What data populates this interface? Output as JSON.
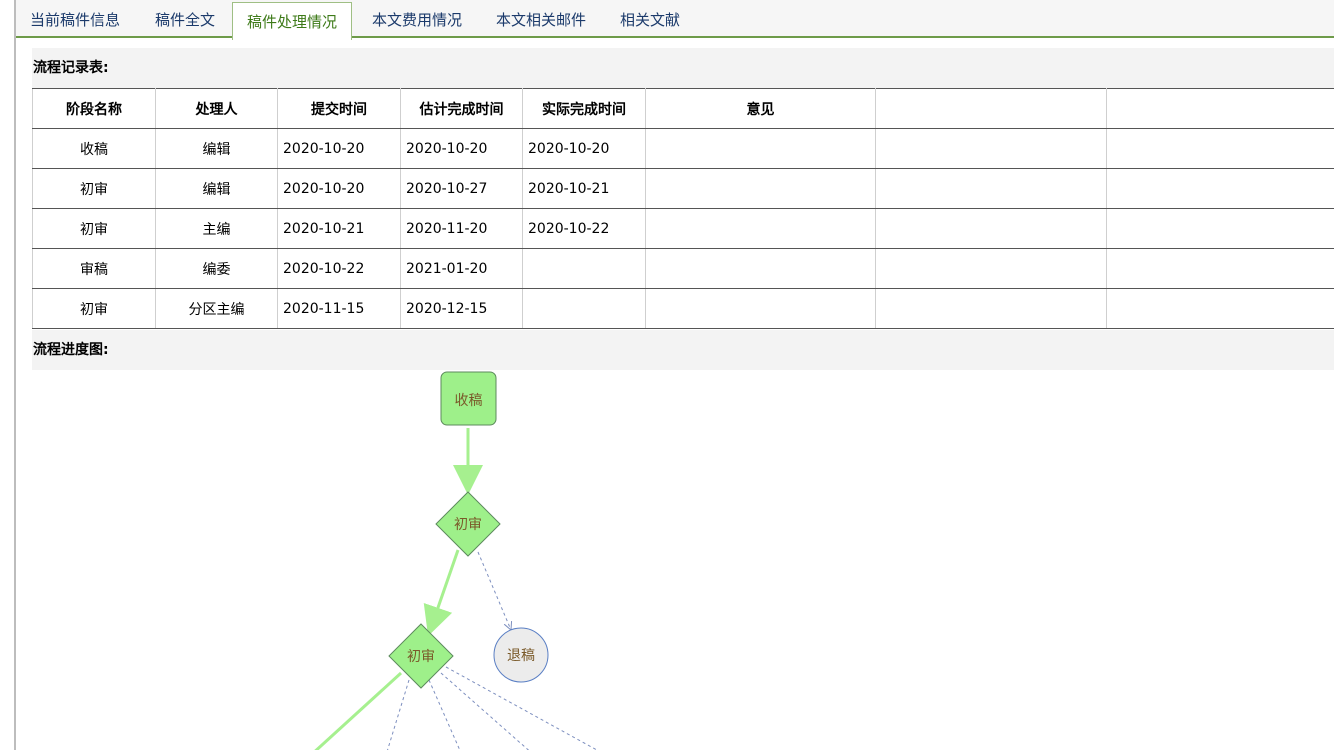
{
  "tabs": [
    {
      "label": "当前稿件信息",
      "active": false
    },
    {
      "label": "稿件全文",
      "active": false
    },
    {
      "label": "稿件处理情况",
      "active": true
    },
    {
      "label": "本文费用情况",
      "active": false
    },
    {
      "label": "本文相关邮件",
      "active": false
    },
    {
      "label": "相关文献",
      "active": false
    }
  ],
  "records": {
    "title": "流程记录表:",
    "columns": [
      "阶段名称",
      "处理人",
      "提交时间",
      "估计完成时间",
      "实际完成时间",
      "意见",
      "",
      ""
    ],
    "rows": [
      [
        "收稿",
        "编辑",
        "2020-10-20",
        "2020-10-20",
        "2020-10-20",
        "",
        "",
        ""
      ],
      [
        "初审",
        "编辑",
        "2020-10-20",
        "2020-10-27",
        "2020-10-21",
        "",
        "",
        ""
      ],
      [
        "初审",
        "主编",
        "2020-10-21",
        "2020-11-20",
        "2020-10-22",
        "",
        "",
        ""
      ],
      [
        "审稿",
        "编委",
        "2020-10-22",
        "2021-01-20",
        "",
        "",
        "",
        ""
      ],
      [
        "初审",
        "分区主编",
        "2020-11-15",
        "2020-12-15",
        "",
        "",
        "",
        ""
      ]
    ]
  },
  "progress": {
    "title": "流程进度图:",
    "nodes": {
      "receive": "收稿",
      "review1": "初审",
      "review2": "初审",
      "reject": "退稿"
    },
    "colors": {
      "active_fill": "#9ef08a",
      "active_line": "#a6f08f",
      "node_stroke": "#5c8a5c",
      "reject_fill": "#ececec",
      "reject_stroke": "#5a7fc4",
      "dashed": "#7d8fbf"
    }
  }
}
